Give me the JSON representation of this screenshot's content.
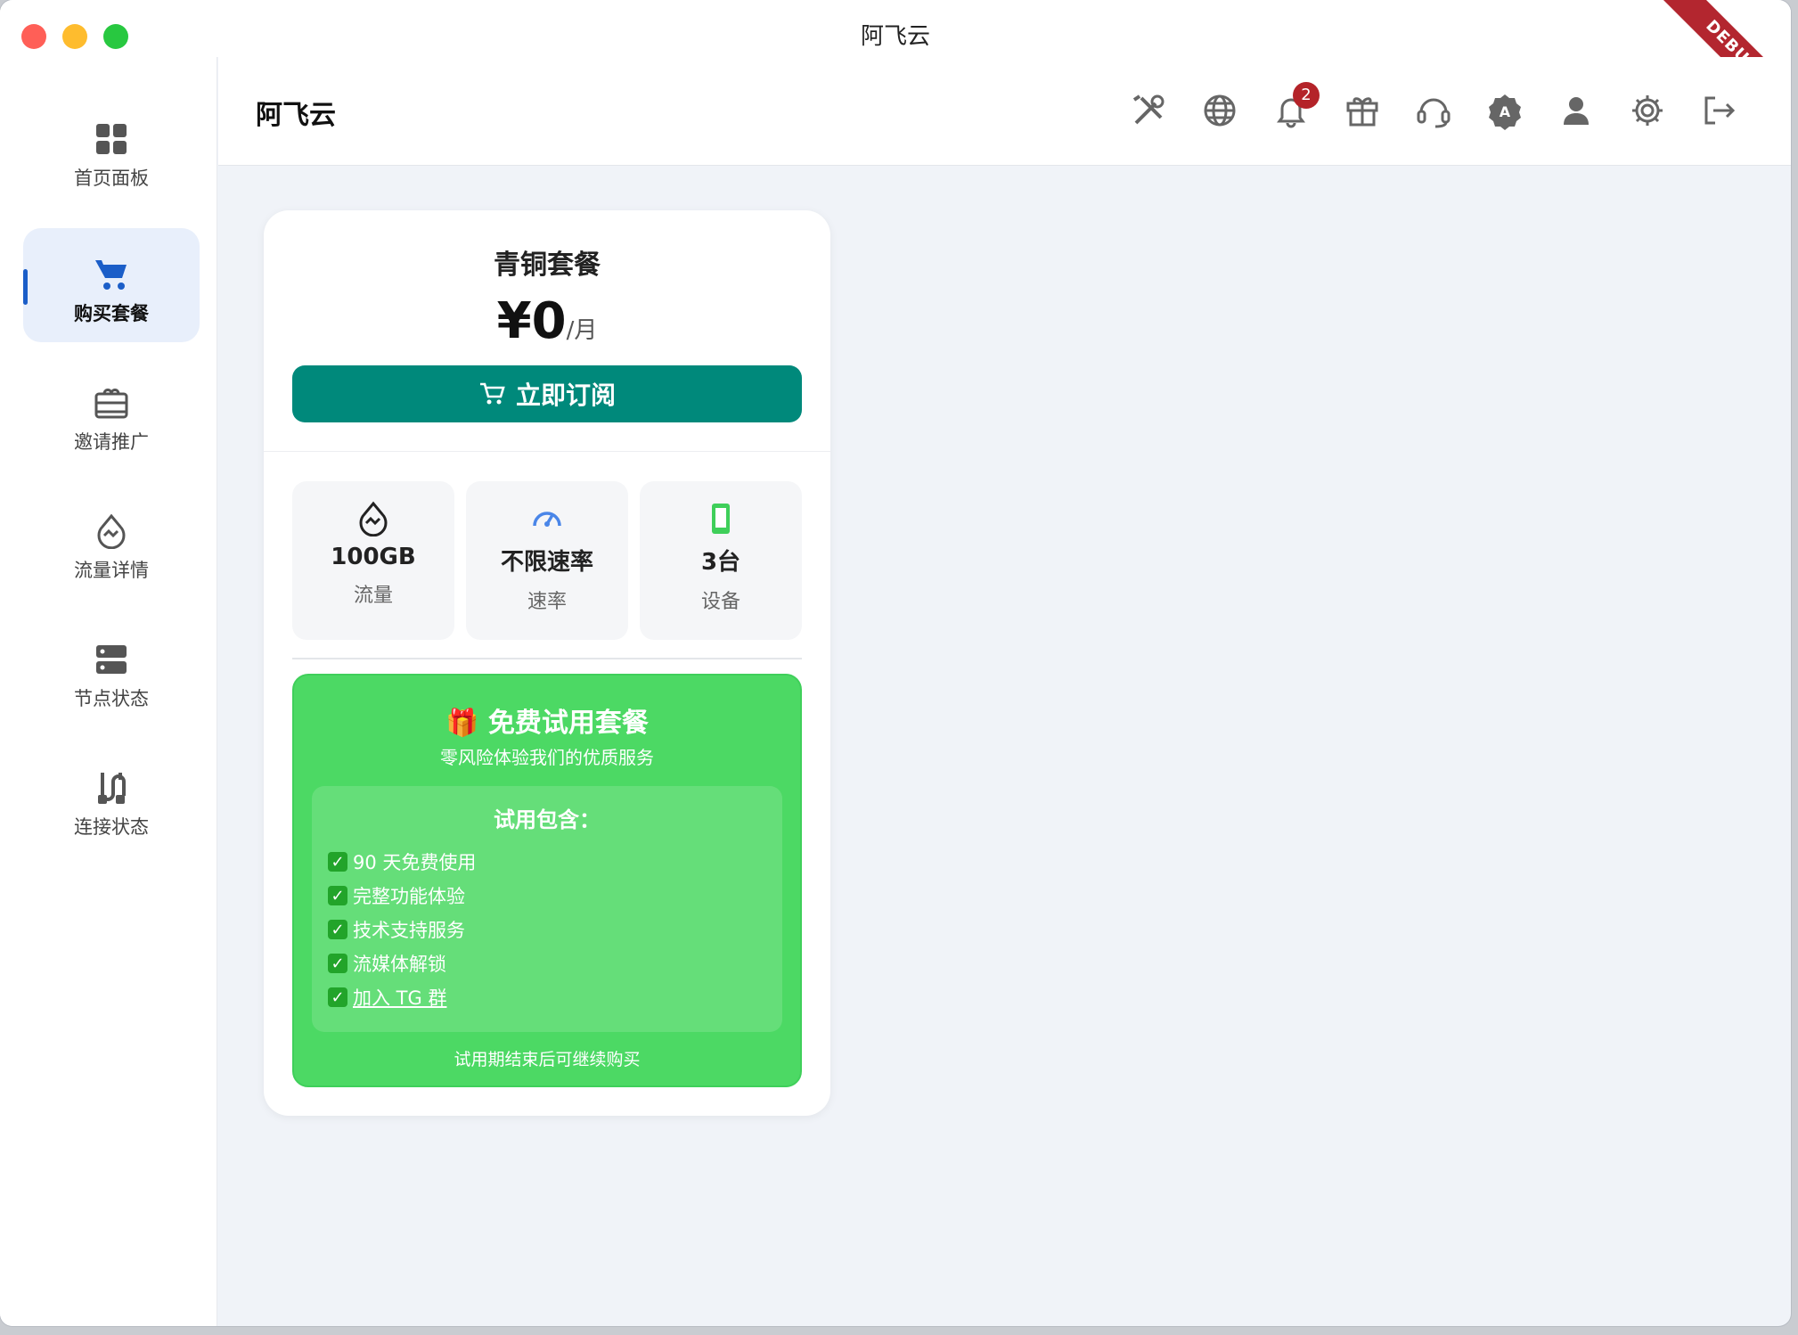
{
  "window": {
    "title": "阿飞云",
    "debug_label": "DEBUG"
  },
  "topbar": {
    "app_name": "阿飞云",
    "notifications_count": "2",
    "icons": [
      "tools-icon",
      "globe-icon",
      "bell-icon",
      "gift-icon",
      "headset-icon",
      "badge-icon",
      "user-icon",
      "settings-icon",
      "logout-icon"
    ]
  },
  "sidebar": {
    "items": [
      {
        "label": "首页面板",
        "icon": "dashboard-icon"
      },
      {
        "label": "购买套餐",
        "icon": "cart-icon",
        "active": true
      },
      {
        "label": "邀请推广",
        "icon": "invite-icon"
      },
      {
        "label": "流量详情",
        "icon": "traffic-icon"
      },
      {
        "label": "节点状态",
        "icon": "server-icon"
      },
      {
        "label": "连接状态",
        "icon": "connection-icon"
      }
    ]
  },
  "plan": {
    "name": "青铜套餐",
    "price": "¥0",
    "unit": "/月",
    "subscribe_label": "立即订阅",
    "features": [
      {
        "value": "100GB",
        "label": "流量",
        "icon": "data-icon"
      },
      {
        "value": "不限速率",
        "label": "速率",
        "icon": "speed-icon"
      },
      {
        "value": "3台",
        "label": "设备",
        "icon": "device-icon"
      }
    ]
  },
  "trial": {
    "title": "🎁 免费试用套餐",
    "subtitle": "零风险体验我们的优质服务",
    "box_title": "试用包含：",
    "items": [
      "90 天免费使用",
      "完整功能体验",
      "技术支持服务",
      "流媒体解锁",
      "加入 TG 群"
    ],
    "footer": "试用期结束后可继续购买"
  },
  "colors": {
    "accent": "#00897b",
    "trial_green": "#4cd964",
    "active_blue": "#1b5ec8",
    "badge_red": "#b42329"
  }
}
